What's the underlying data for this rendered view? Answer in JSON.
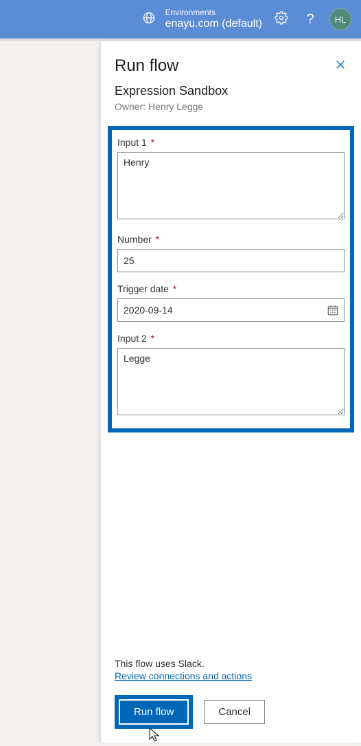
{
  "header": {
    "env_label": "Environments",
    "env_name": "enayu.com (default)",
    "avatar_initials": "HL"
  },
  "panel": {
    "title": "Run flow",
    "subtitle": "Expression Sandbox",
    "owner": "Owner: Henry Legge",
    "fields": {
      "input1_label": "Input 1",
      "input1_value": "Henry",
      "number_label": "Number",
      "number_value": "25",
      "triggerdate_label": "Trigger date",
      "triggerdate_value": "2020-09-14",
      "input2_label": "Input 2",
      "input2_value": "Legge"
    },
    "footer": {
      "uses_text": "This flow uses Slack.",
      "review_link": "Review connections and actions",
      "run_label": "Run flow",
      "cancel_label": "Cancel"
    }
  }
}
